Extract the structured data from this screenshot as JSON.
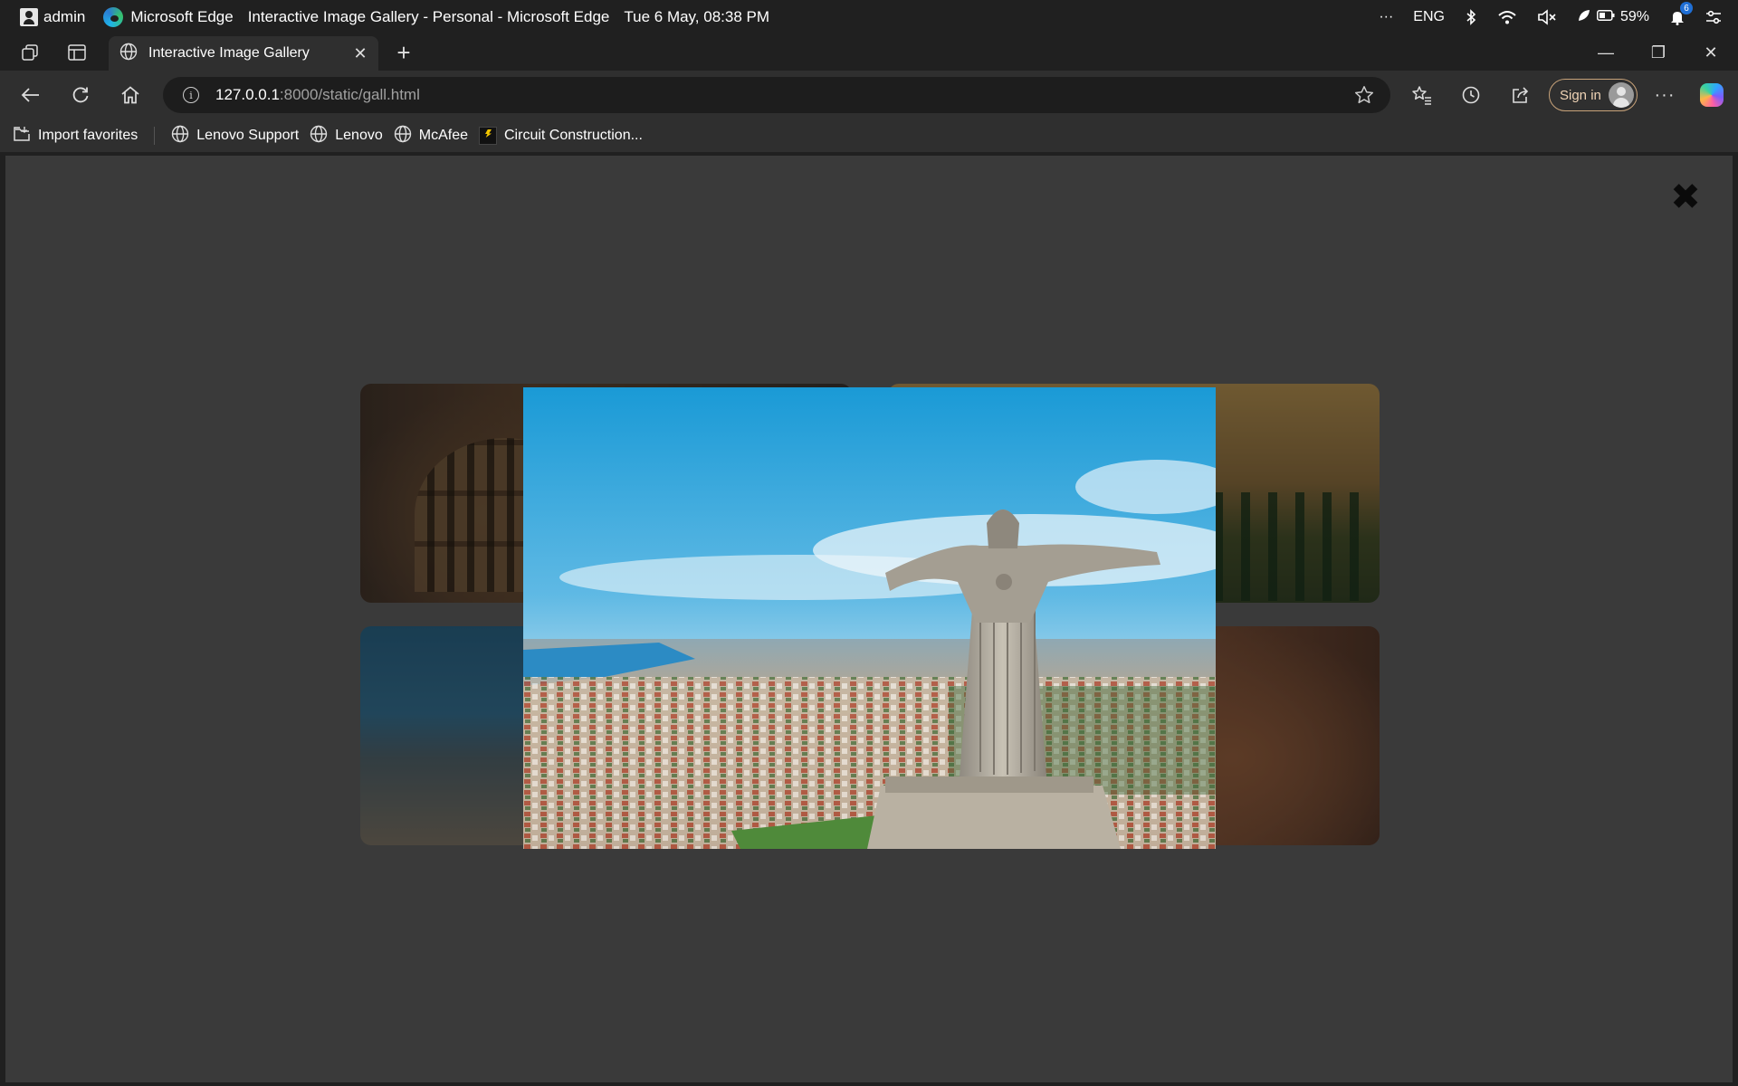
{
  "os_bar": {
    "user": "admin",
    "app_name": "Microsoft Edge",
    "window_title": "Interactive Image Gallery - Personal - Microsoft Edge",
    "datetime": "Tue 6 May, 08:38 PM",
    "overflow": "···",
    "language": "ENG",
    "battery": "59%",
    "notifications_count": "6"
  },
  "tab": {
    "title": "Interactive Image Gallery",
    "close_glyph": "✕",
    "new_tab_glyph": "+"
  },
  "window_controls": {
    "minimize": "—",
    "restore": "❐",
    "close": "✕"
  },
  "address_bar": {
    "url_host": "127.0.0.1",
    "url_rest": ":8000/static/gall.html",
    "sign_in": "Sign in",
    "more": "···"
  },
  "favorites": {
    "import": "Import favorites",
    "items": [
      "Lenovo Support",
      "Lenovo",
      "McAfee",
      "Circuit Construction..."
    ]
  },
  "lightbox": {
    "close_glyph": "✖"
  },
  "icons": {
    "os": [
      "user-icon",
      "edge-logo-icon",
      "bluetooth-icon",
      "wifi-icon",
      "volume-muted-icon",
      "battery-saver-icon",
      "battery-icon",
      "bell-icon",
      "quick-settings-icon"
    ],
    "tabs": [
      "workspaces-icon",
      "vertical-tabs-icon",
      "globe-icon",
      "close-icon",
      "plus-icon"
    ],
    "nav": [
      "back-icon",
      "refresh-icon",
      "home-icon",
      "info-icon",
      "star-icon",
      "favorites-icon",
      "history-icon",
      "share-icon",
      "avatar",
      "more-icon",
      "copilot-icon"
    ]
  },
  "colors": {
    "chrome_dark": "#202020",
    "toolbar": "#2f2f2f",
    "page_bg": "#3a3a3a",
    "signin_border": "#c8a37a"
  }
}
